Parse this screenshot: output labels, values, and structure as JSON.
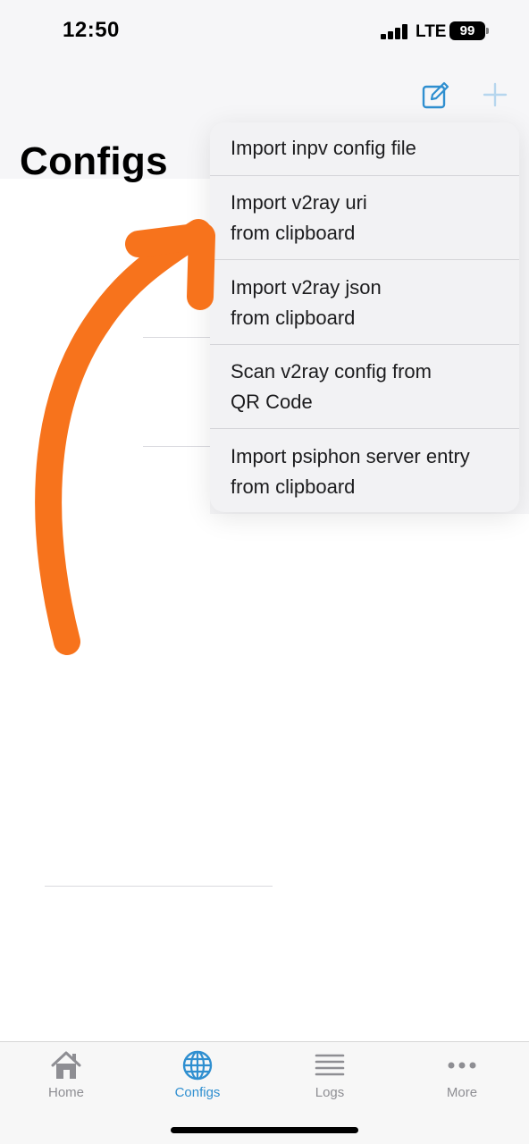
{
  "status_bar": {
    "time": "12:50",
    "network": "LTE",
    "battery": "99"
  },
  "nav": {
    "edit_icon": "compose-icon",
    "add_icon": "plus-icon",
    "accent_color": "#2f8fd0"
  },
  "page": {
    "title": "Configs"
  },
  "menu": {
    "items": [
      {
        "line1": "Import inpv config file",
        "line2": ""
      },
      {
        "line1": "Import v2ray uri",
        "line2": "from clipboard"
      },
      {
        "line1": "Import v2ray json",
        "line2": "from clipboard"
      },
      {
        "line1": "Scan v2ray config from",
        "line2": "QR Code"
      },
      {
        "line1": "Import psiphon server entry",
        "line2": "from clipboard"
      }
    ]
  },
  "annotation": {
    "arrow_color": "#f7731c"
  },
  "tabbar": {
    "tabs": [
      {
        "label": "Home",
        "icon": "house-icon",
        "active": false
      },
      {
        "label": "Configs",
        "icon": "globe-icon",
        "active": true
      },
      {
        "label": "Logs",
        "icon": "list-icon",
        "active": false
      },
      {
        "label": "More",
        "icon": "ellipsis-icon",
        "active": false
      }
    ]
  }
}
